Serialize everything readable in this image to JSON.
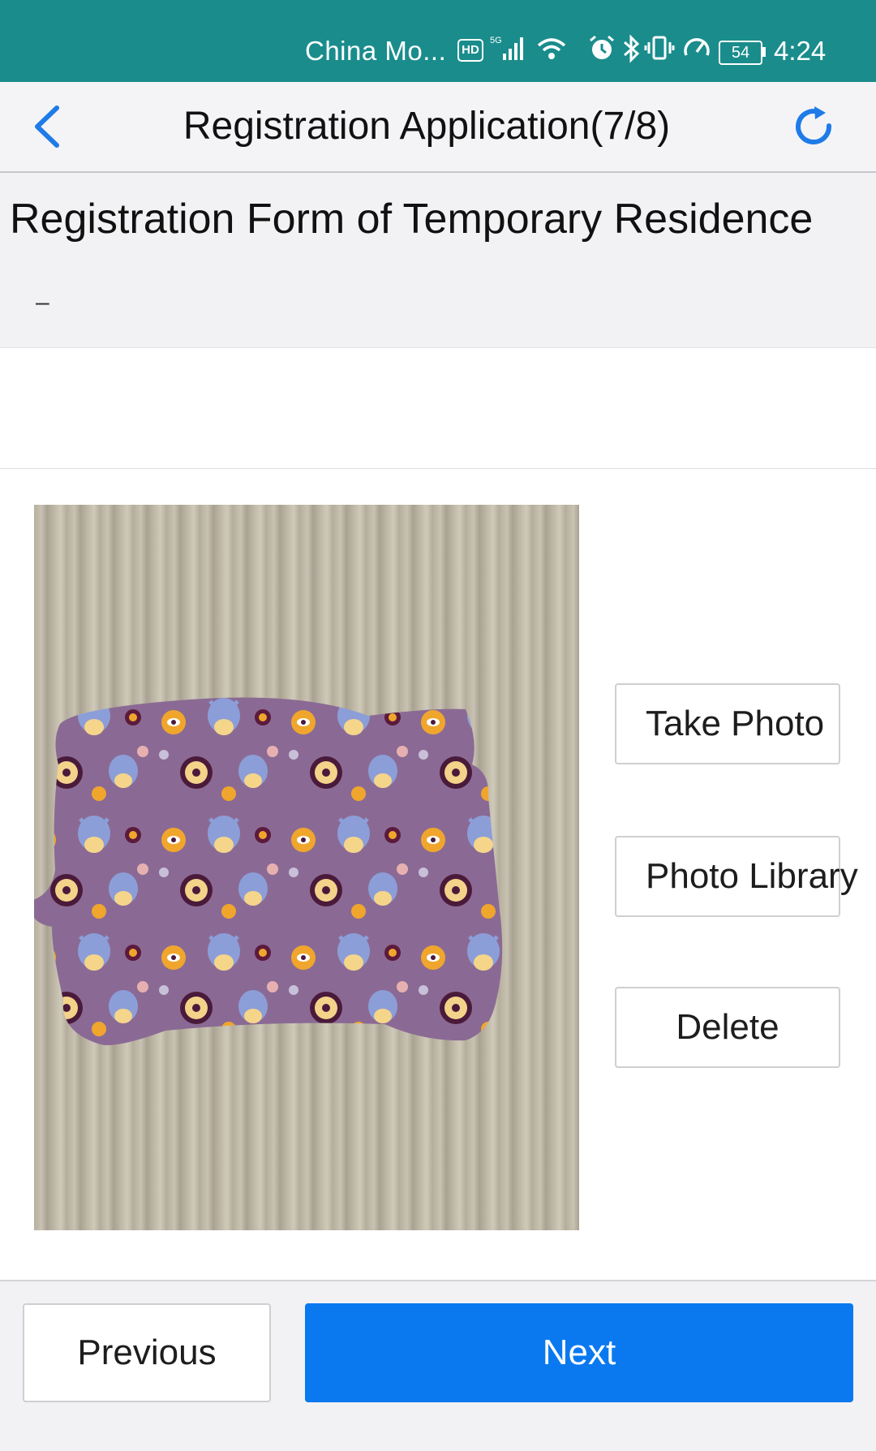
{
  "status_bar": {
    "carrier": "China Mo...",
    "hd_label": "HD",
    "network_label": "5G",
    "battery_level": "54",
    "time": "4:24",
    "icons": [
      "hd-icon",
      "signal-icon",
      "wifi-icon",
      "alarm-icon",
      "bluetooth-icon",
      "vibrate-icon",
      "speed-icon",
      "battery-icon"
    ]
  },
  "nav": {
    "title": "Registration Application(7/8)",
    "back_icon": "chevron-left-icon",
    "refresh_icon": "refresh-icon"
  },
  "form": {
    "heading": "Registration Form of Temporary Residence",
    "note": "–"
  },
  "photo": {
    "take_photo_label": "Take Photo",
    "photo_library_label": "Photo Library",
    "delete_label": "Delete"
  },
  "footer": {
    "previous_label": "Previous",
    "next_label": "Next"
  },
  "colors": {
    "status_bar": "#1a8c8c",
    "accent": "#0a79f0",
    "back_icon": "#1e7be8",
    "fabric": "#8a6a94"
  }
}
